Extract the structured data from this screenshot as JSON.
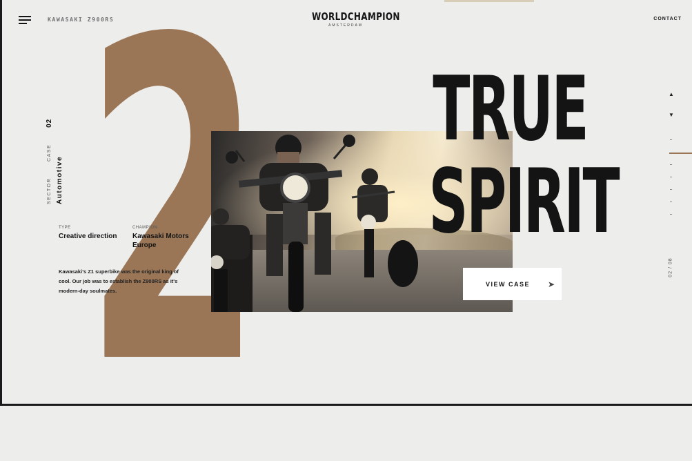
{
  "header": {
    "breadcrumb": "KAWASAKI Z900RS",
    "brand_name": "WORLDCHAMPION",
    "brand_city": "AMSTERDAM",
    "contact_label": "CONTACT"
  },
  "case": {
    "number": "2",
    "sector_label": "SECTOR",
    "case_label": "CASE",
    "case_number": "02",
    "sector_value": "Automotive",
    "type_label": "TYPE",
    "type_value": "Creative direction",
    "champion_label": "CHAMPION",
    "champion_value": "Kawasaki Motors Europe",
    "description": "Kawasaki's Z1 superbike was the original king of cool. Our job was to establish the Z900RS as it's modern-day soulmates.",
    "headline_line1": "TRUE",
    "headline_line2": "SPIRIT",
    "cta_label": "VIEW CASE"
  },
  "side_nav": {
    "counter": "02 / 08"
  },
  "colors": {
    "accent": "#9a7657",
    "background": "#ededec",
    "ink": "#151515"
  },
  "icons": {
    "menu": "menu-icon",
    "up": "arrow-up-icon",
    "down": "arrow-down-icon",
    "cta": "arrow-right-icon"
  }
}
